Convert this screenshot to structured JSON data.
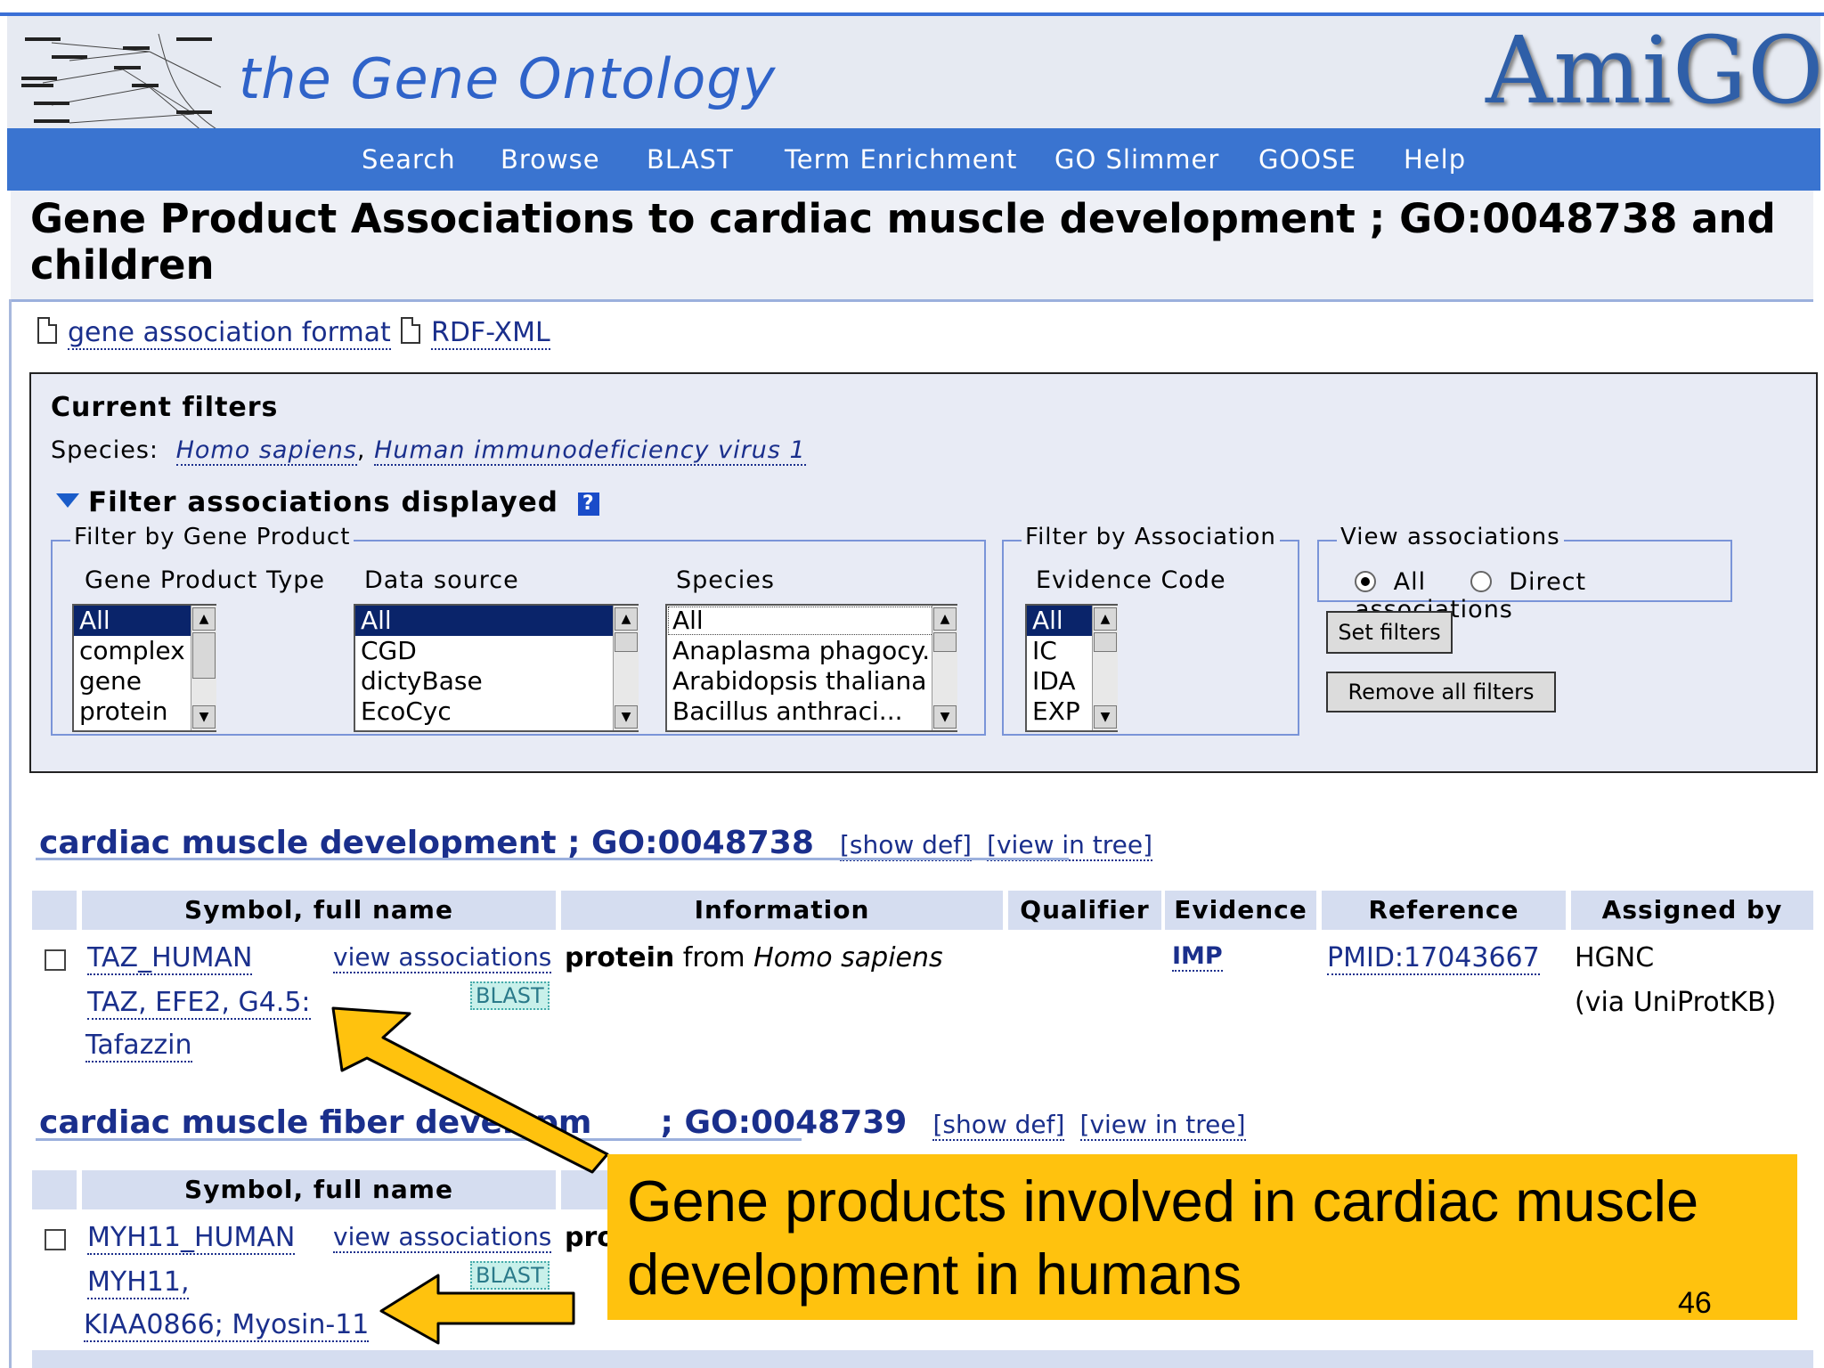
{
  "site": {
    "title": "the Gene Ontology",
    "logo": "AmiGO"
  },
  "nav": [
    "Search",
    "Browse",
    "BLAST",
    "Term Enrichment",
    "GO Slimmer",
    "GOOSE",
    "Help"
  ],
  "page_title": "Gene Product Associations to cardiac muscle development ; GO:0048738 and children",
  "downloads": [
    "gene association format",
    "RDF-XML"
  ],
  "filters": {
    "current_title": "Current filters",
    "species_label": "Species:",
    "species": [
      "Homo sapiens",
      "Human immunodeficiency virus 1"
    ],
    "toggle_label": "Filter associations displayed",
    "gene_product_legend": "Filter by Gene Product",
    "gp_type_label": "Gene Product Type",
    "gp_type_options": [
      "All",
      "complex",
      "gene",
      "protein"
    ],
    "data_source_label": "Data source",
    "data_source_options": [
      "All",
      "CGD",
      "dictyBase",
      "EcoCyc"
    ],
    "species_col_label": "Species",
    "species_options": [
      "All",
      "Anaplasma phagocy...",
      "Arabidopsis thaliana",
      "Bacillus anthraci..."
    ],
    "association_legend": "Filter by Association",
    "evidence_label": "Evidence Code",
    "evidence_options": [
      "All",
      "IC",
      "IDA",
      "EXP"
    ],
    "view_legend": "View associations",
    "view_all": "All",
    "view_direct": "Direct associations",
    "set_button": "Set filters",
    "remove_button": "Remove all filters"
  },
  "columns": [
    "Symbol, full name",
    "Information",
    "Qualifier",
    "Evidence",
    "Reference",
    "Assigned by"
  ],
  "sections": [
    {
      "term": "cardiac muscle development ; GO:0048738",
      "show_def": "[show def]",
      "view_tree": "[view in tree]",
      "row": {
        "symbol": "TAZ_HUMAN",
        "synonyms": "TAZ, EFE2, G4.5:",
        "full_name": "Tafazzin",
        "view_assoc": "view associations",
        "blast": "BLAST",
        "info_type": "protein",
        "info_from": "from",
        "info_species": "Homo sapiens",
        "evidence": "IMP",
        "reference": "PMID:17043667",
        "assigned_by": "HGNC",
        "assigned_via": "(via UniProtKB)"
      }
    },
    {
      "term_a": "cardiac muscle fiber developm",
      "term_b": "; GO:0048739",
      "show_def": "[show def]",
      "view_tree": "[view in tree]",
      "row": {
        "symbol": "MYH11_HUMAN",
        "synonyms": "MYH11,",
        "full_name": "KIAA0866; Myosin-11",
        "view_assoc": "view associations",
        "blast": "BLAST",
        "info_partial": "pro"
      }
    }
  ],
  "callout": {
    "line1": "Gene products involved in cardiac muscle",
    "line2": "development in humans"
  },
  "slide_number": "46",
  "colors": {
    "nav_blue": "#3a74d0",
    "callout_yellow": "#ffc20e",
    "link_blue": "#1a2f8c",
    "header_blue": "#d5ddf0"
  }
}
